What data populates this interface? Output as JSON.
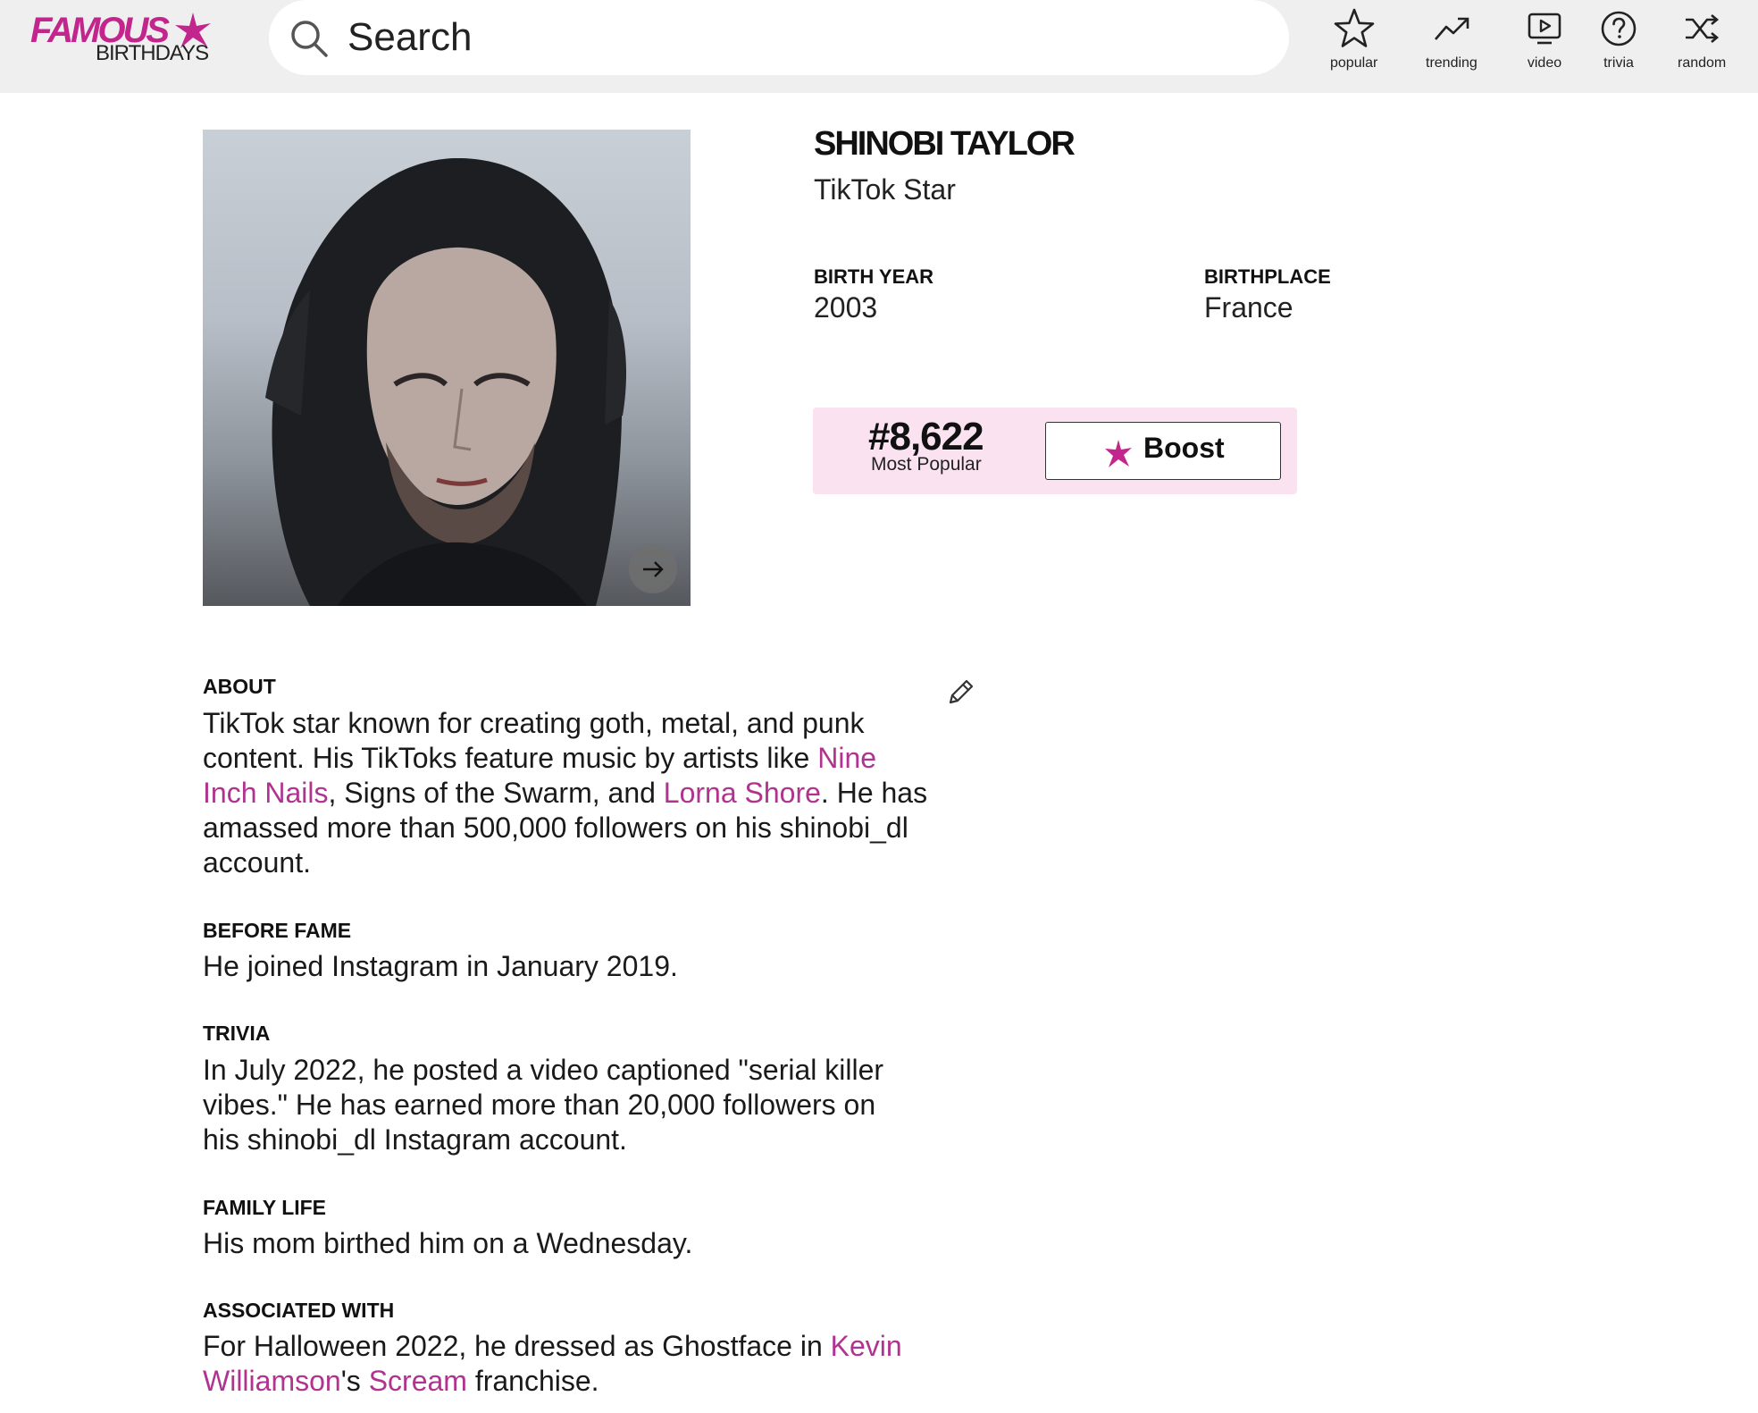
{
  "header": {
    "logo_top": "FAMOUS",
    "logo_bottom": "BIRTHDAYS",
    "search_placeholder": "Search",
    "nav": [
      {
        "label": "popular",
        "icon": "star-icon"
      },
      {
        "label": "trending",
        "icon": "trending-icon"
      },
      {
        "label": "video",
        "icon": "video-icon"
      },
      {
        "label": "trivia",
        "icon": "question-icon"
      },
      {
        "label": "random",
        "icon": "shuffle-icon"
      }
    ]
  },
  "profile": {
    "name": "SHINOBI TAYLOR",
    "profession": "TikTok Star",
    "birth_year_label": "BIRTH YEAR",
    "birth_year": "2003",
    "birthplace_label": "BIRTHPLACE",
    "birthplace": "France",
    "rank": "#8,622",
    "rank_label": "Most Popular",
    "boost_label": "Boost",
    "photo_icon": "arrow-right-icon"
  },
  "about": {
    "label": "ABOUT",
    "parts": [
      "TikTok star known for creating goth, metal, and punk content. His TikToks feature music by artists like ",
      "Nine Inch Nails",
      ", Signs of the Swarm, and ",
      "Lorna Shore",
      ". He has amassed more than 500,000 followers on his shinobi_dl account."
    ]
  },
  "before_fame": {
    "label": "BEFORE FAME",
    "text": "He joined Instagram in January 2019."
  },
  "trivia": {
    "label": "TRIVIA",
    "text": "In July 2022, he posted a video captioned \"serial killer vibes.\" He has earned more than 20,000 followers on his shinobi_dl Instagram account."
  },
  "family_life": {
    "label": "FAMILY LIFE",
    "text": "His mom birthed him on a Wednesday."
  },
  "associated_with": {
    "label": "ASSOCIATED WITH",
    "parts": [
      "For Halloween 2022, he dressed as Ghostface in ",
      "Kevin Williamson",
      "'s ",
      "Scream",
      " franchise."
    ]
  },
  "colors": {
    "brand_pink": "#c2268c",
    "link": "#b0338f",
    "rank_bg": "#fbe2f0",
    "header_bg": "#efefef"
  }
}
